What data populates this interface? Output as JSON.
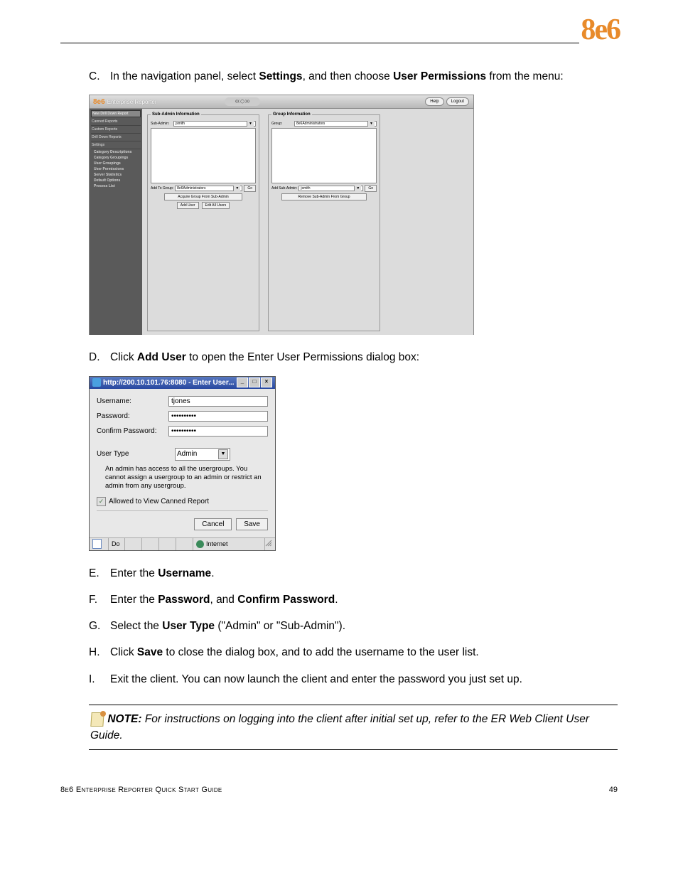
{
  "brand": "8e6",
  "steps": {
    "c": {
      "letter": "C.",
      "pre": "In the navigation panel, select ",
      "b1": "Settings",
      "mid": ", and then choose ",
      "b2": "User Permissions",
      "post": " from the menu:"
    },
    "d": {
      "letter": "D.",
      "pre": "Click ",
      "b1": "Add User",
      "post": " to open the Enter User Permissions dialog box:"
    },
    "e": {
      "letter": "E.",
      "pre": "Enter the ",
      "b1": "Username",
      "post": "."
    },
    "f": {
      "letter": "F.",
      "pre": "Enter the ",
      "b1": "Password",
      "mid": ", and ",
      "b2": "Confirm Password",
      "post": "."
    },
    "g": {
      "letter": "G.",
      "pre": "Select the ",
      "b1": "User Type",
      "post": " (\"Admin\" or \"Sub-Admin\")."
    },
    "h": {
      "letter": "H.",
      "pre": "Click ",
      "b1": "Save",
      "post": " to close the dialog box, and to add the username to the user list."
    },
    "i": {
      "letter": "I.",
      "text": "Exit the client. You can now launch the client and enter the password you just set up."
    }
  },
  "ss1": {
    "brand": "8e6",
    "title": "Enterprise Reporter",
    "help": "Help",
    "logout": "Logout",
    "sidebar": {
      "top": "New Drill Down Report",
      "items": [
        "Canned Reports",
        "Custom Reports",
        "Drill Down Reports",
        "Settings"
      ],
      "subs": [
        "Category Descriptions",
        "Category Groupings",
        "User Groupings",
        "User Permissions",
        "Server Statistics",
        "Default Options",
        "Process List"
      ]
    },
    "subadmin": {
      "legend": "Sub-Admin Information",
      "label": "Sub-Admin:",
      "value": "jsmith",
      "addto_label": "Add To Group:",
      "addto_value": "8e6Administrators",
      "go": "Go",
      "acquire": "Acquire Group From Sub-Admin",
      "adduser": "Add User",
      "editall": "Edit All Users"
    },
    "group": {
      "legend": "Group Information",
      "label": "Group:",
      "value": "8e6Administrators",
      "addsub_label": "Add Sub-Admin:",
      "addsub_value": "jsmith",
      "go": "Go",
      "remove": "Remove Sub-Admin From Group"
    }
  },
  "ss2": {
    "title": "http://200.10.101.76:8080 - Enter User...",
    "username_label": "Username:",
    "username_value": "tjones",
    "password_label": "Password:",
    "password_value": "••••••••••",
    "confirm_label": "Confirm Password:",
    "confirm_value": "••••••••••",
    "usertype_label": "User Type",
    "usertype_value": "Admin",
    "desc": "An admin has access to all the usergroups. You cannot assign a usergroup to an admin or restrict an admin from any usergroup.",
    "check_label": "Allowed to View Canned Report",
    "cancel": "Cancel",
    "save": "Save",
    "status_done": "Do",
    "status_internet": "Internet"
  },
  "note": {
    "label": "NOTE:",
    "text": " For instructions on logging into the client after initial set up, refer to the ER Web Client User Guide."
  },
  "footer": {
    "title": "8e6 Enterprise Reporter Quick Start Guide",
    "page": "49"
  }
}
